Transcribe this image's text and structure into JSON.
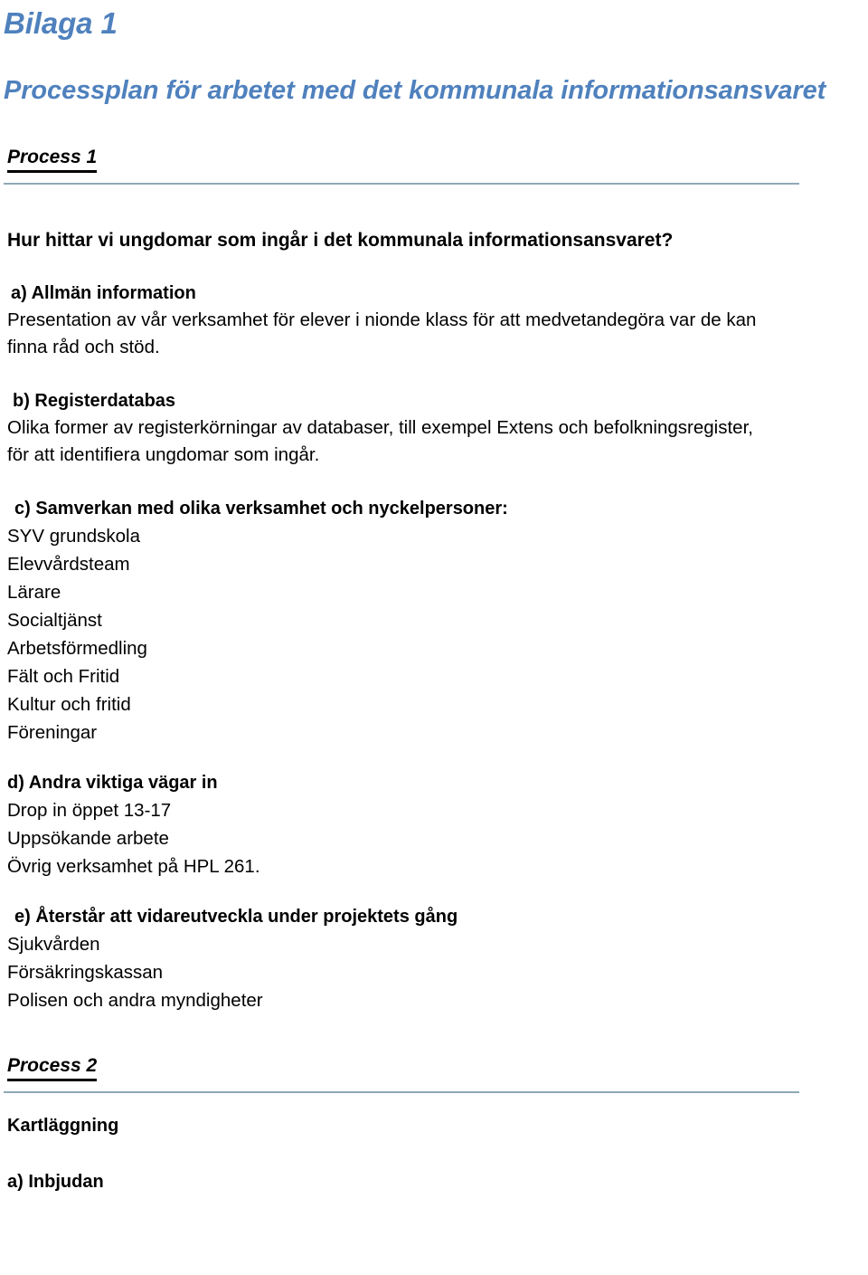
{
  "document": {
    "appendix_label": "Bilaga 1",
    "title": "Processplan för arbetet med det kommunala informationsansvaret",
    "title_color": "#4F81BD",
    "rule_color": "#8FA9B6"
  },
  "process_1": {
    "heading": "Process 1",
    "question": "Hur hittar vi ungdomar som ingår i det kommunala informationsansvaret?",
    "sections": {
      "a": {
        "heading": "a) Allmän information",
        "lines": [
          "Presentation av vår verksamhet för elever i nionde klass för att medvetandegöra var de kan",
          "finna råd och stöd."
        ]
      },
      "b": {
        "heading": "b) Registerdatabas",
        "lines": [
          "Olika former av registerkörningar av databaser, till exempel Extens och befolkningsregister,",
          "för att identifiera ungdomar som ingår."
        ]
      },
      "c": {
        "heading": "c) Samverkan med olika verksamhet och nyckelpersoner:",
        "items": [
          "SYV grundskola",
          "Elevvårdsteam",
          "Lärare",
          "Socialtjänst",
          "Arbetsförmedling",
          "Fält och Fritid",
          "Kultur och fritid",
          "Föreningar"
        ]
      },
      "d": {
        "heading": "d) Andra viktiga vägar in",
        "items": [
          "Drop in öppet 13-17",
          "Uppsökande arbete",
          "Övrig verksamhet på HPL 261."
        ]
      },
      "e": {
        "heading": "e) Återstår att vidareutveckla under projektets gång",
        "items": [
          "Sjukvården",
          "Försäkringskassan",
          "Polisen och andra myndigheter"
        ]
      }
    }
  },
  "process_2": {
    "heading": "Process 2",
    "subtitle": "Kartläggning",
    "section_a_heading": "a) Inbjudan"
  }
}
